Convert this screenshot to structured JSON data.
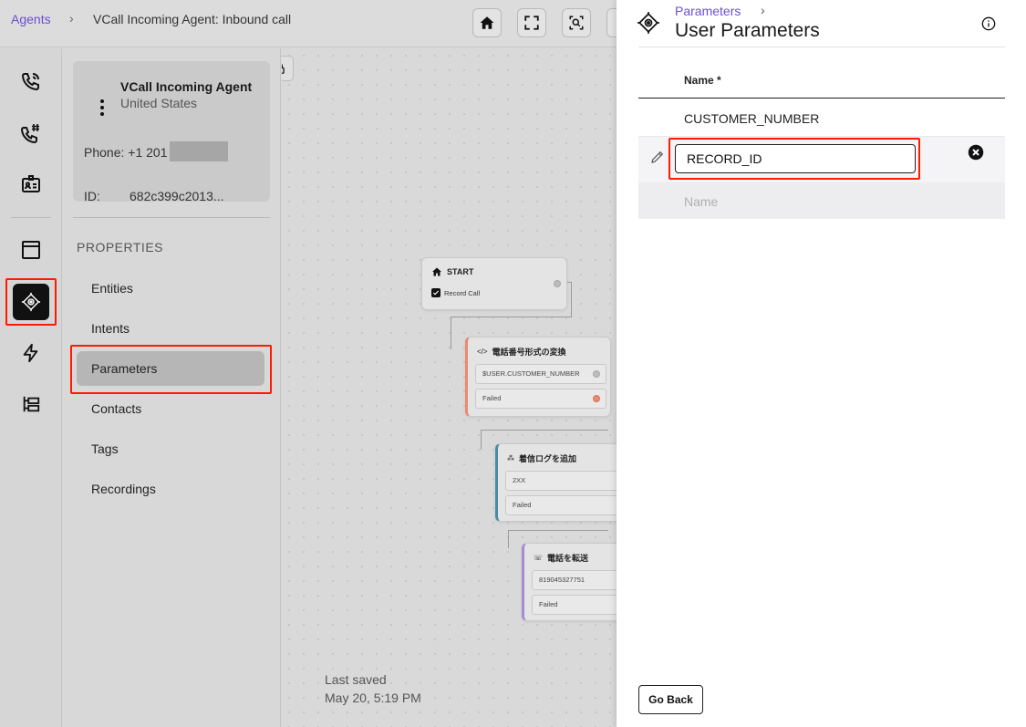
{
  "topbar": {
    "breadcrumb_link": "Agents",
    "breadcrumb_sep": "›",
    "breadcrumb_title": "VCall Incoming Agent: Inbound call",
    "buttons": [
      "home-icon",
      "fullscreen-icon",
      "zoom-fit-icon"
    ]
  },
  "rail": {
    "items": [
      "phone-incoming-icon",
      "phone-hash-icon",
      "id-card-icon",
      "window-icon",
      "parameters-icon",
      "lightning-icon",
      "tree-icon"
    ],
    "active": "parameters-icon"
  },
  "agent": {
    "name": "VCall Incoming Agent",
    "country": "United States",
    "phone_label": "Phone:",
    "phone_value": "+1 201",
    "id_label": "ID:",
    "id_value": "682c399c2013..."
  },
  "properties": {
    "heading": "PROPERTIES",
    "items": [
      "Entities",
      "Intents",
      "Parameters",
      "Contacts",
      "Tags",
      "Recordings"
    ],
    "active": "Parameters"
  },
  "canvas": {
    "start_node": {
      "title": "START",
      "checkbox_label": "Record Call",
      "checked": true
    },
    "convert_node": {
      "title": "電話番号形式の変換",
      "field": "$USER.CUSTOMER_NUMBER",
      "failed": "Failed"
    },
    "log_node": {
      "title": "着信ログを追加",
      "field": "2XX",
      "failed": "Failed"
    },
    "transfer_node": {
      "title": "電話を転送",
      "field": "819045327751",
      "failed": "Failed"
    },
    "saved_label": "Last saved",
    "saved_value": "May 20, 5:19 PM"
  },
  "drawer": {
    "breadcrumb": "Parameters",
    "breadcrumb_sep": "›",
    "title": "User Parameters",
    "column_name": "Name *",
    "rows": [
      "CUSTOMER_NUMBER"
    ],
    "editing_value": "RECORD_ID",
    "new_placeholder": "Name",
    "go_back_label": "Go Back"
  },
  "colors": {
    "accent": "#6b4fd0",
    "highlight": "#ff1a00",
    "failed_port": "#e98a72"
  }
}
